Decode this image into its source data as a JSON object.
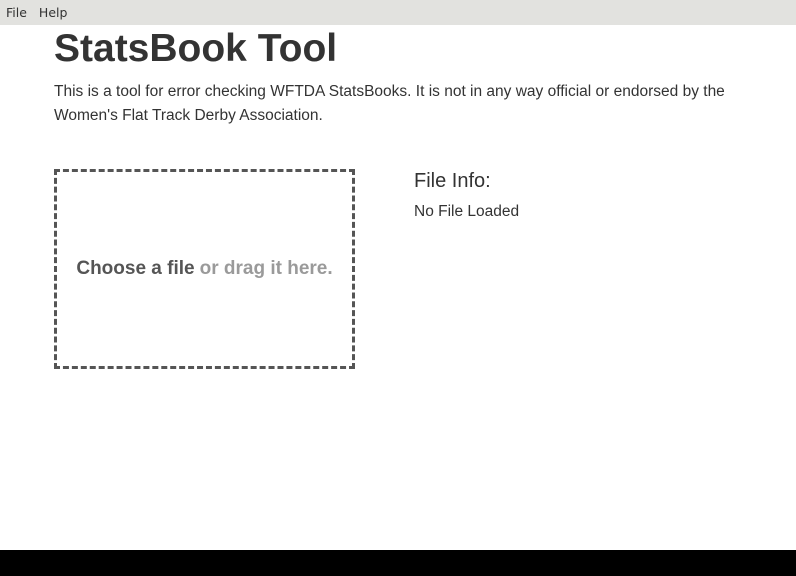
{
  "menubar": {
    "items": [
      {
        "label": "File"
      },
      {
        "label": "Help"
      }
    ]
  },
  "main": {
    "title": "StatsBook Tool",
    "intro": "This is a tool for error checking WFTDA StatsBooks. It is not in any way official or endorsed by the Women's Flat Track Derby Association."
  },
  "dropzone": {
    "choose_label": "Choose a file",
    "drag_label": "or drag it here."
  },
  "file_info": {
    "title": "File Info:",
    "status": "No File Loaded"
  },
  "colors": {
    "menubar_bg": "#e2e2df",
    "text": "#333333",
    "dropzone_border": "#555555",
    "drag_text": "#9a9a9a",
    "footer_bg": "#000000"
  }
}
